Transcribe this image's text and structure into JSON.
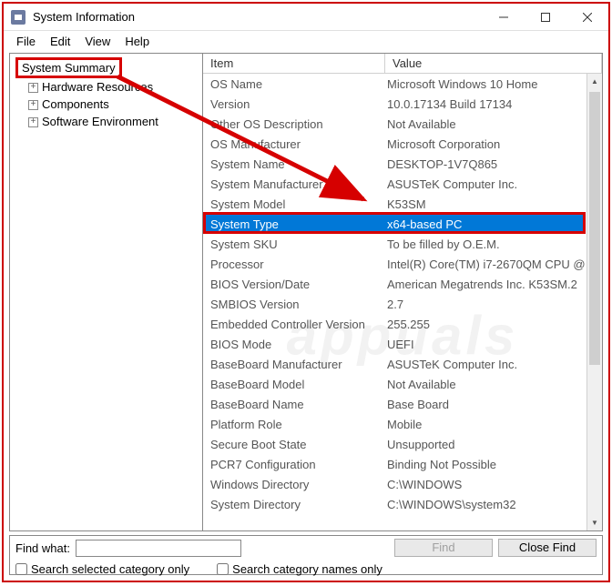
{
  "window": {
    "title": "System Information"
  },
  "menu": {
    "file": "File",
    "edit": "Edit",
    "view": "View",
    "help": "Help"
  },
  "tree": {
    "root": "System Summary",
    "items": [
      {
        "label": "Hardware Resources"
      },
      {
        "label": "Components"
      },
      {
        "label": "Software Environment"
      }
    ]
  },
  "list": {
    "col_item": "Item",
    "col_value": "Value",
    "rows": [
      {
        "item": "OS Name",
        "value": "Microsoft Windows 10 Home"
      },
      {
        "item": "Version",
        "value": "10.0.17134 Build 17134"
      },
      {
        "item": "Other OS Description",
        "value": "Not Available"
      },
      {
        "item": "OS Manufacturer",
        "value": "Microsoft Corporation"
      },
      {
        "item": "System Name",
        "value": "DESKTOP-1V7Q865"
      },
      {
        "item": "System Manufacturer",
        "value": "ASUSTeK Computer Inc."
      },
      {
        "item": "System Model",
        "value": "K53SM"
      },
      {
        "item": "System Type",
        "value": "x64-based PC"
      },
      {
        "item": "System SKU",
        "value": "To be filled by O.E.M."
      },
      {
        "item": "Processor",
        "value": "Intel(R) Core(TM) i7-2670QM CPU @"
      },
      {
        "item": "BIOS Version/Date",
        "value": "American Megatrends Inc. K53SM.2"
      },
      {
        "item": "SMBIOS Version",
        "value": "2.7"
      },
      {
        "item": "Embedded Controller Version",
        "value": "255.255"
      },
      {
        "item": "BIOS Mode",
        "value": "UEFI"
      },
      {
        "item": "BaseBoard Manufacturer",
        "value": "ASUSTeK Computer Inc."
      },
      {
        "item": "BaseBoard Model",
        "value": "Not Available"
      },
      {
        "item": "BaseBoard Name",
        "value": "Base Board"
      },
      {
        "item": "Platform Role",
        "value": "Mobile"
      },
      {
        "item": "Secure Boot State",
        "value": "Unsupported"
      },
      {
        "item": "PCR7 Configuration",
        "value": "Binding Not Possible"
      },
      {
        "item": "Windows Directory",
        "value": "C:\\WINDOWS"
      },
      {
        "item": "System Directory",
        "value": "C:\\WINDOWS\\system32"
      }
    ],
    "selected_index": 7
  },
  "find": {
    "label": "Find what:",
    "value": "",
    "btn_find": "Find",
    "btn_close": "Close Find",
    "chk_selected": "Search selected category only",
    "chk_names": "Search category names only"
  },
  "watermark": "appuals"
}
